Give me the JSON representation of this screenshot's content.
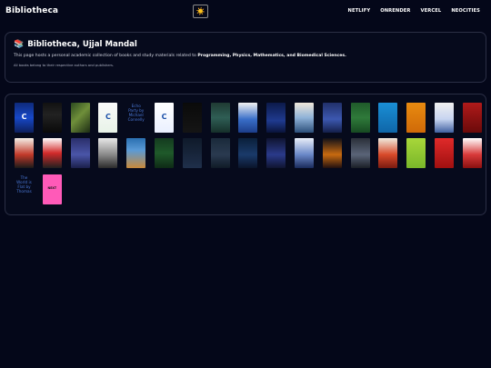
{
  "app": {
    "brand": "Bibliotheca",
    "theme_toggle_glyph": "☀️",
    "nav": [
      "NETLIFY",
      "ONRENDER",
      "VERCEL",
      "NEOCITIES"
    ]
  },
  "intro": {
    "books_icon": "📚",
    "title": "Bibliotheca, Ujjal Mandal",
    "description_start": "This page hosts a personal academic collection of books and study materials related to ",
    "description_fields": "Programming, Physics, Mathematics, and Biomedical Sciences.",
    "note": "All books belong to their respective authors and publishers."
  },
  "books": [
    {
      "kind": "cover",
      "bg": "linear-gradient(180deg,#0e2a7a 0%,#1748c8 50%,#0d1f5c 100%)",
      "title": "C"
    },
    {
      "kind": "cover",
      "bg": "linear-gradient(180deg,#111 0%,#222 40%,#0a0a0a 100%)",
      "title": ""
    },
    {
      "kind": "cover",
      "bg": "linear-gradient(135deg,#2b4a1f 0%,#6f8f3a 45%,#1c2b14 100%)",
      "title": ""
    },
    {
      "kind": "cover",
      "bg": "linear-gradient(180deg,#fafafa 0%,#e8f3e8 100%)",
      "title": "C",
      "dark": true
    },
    {
      "kind": "alt",
      "alt": "Echo Party by Michael Connelly"
    },
    {
      "kind": "cover",
      "bg": "linear-gradient(180deg,#ffffff 0%,#eaf0ff 100%)",
      "title": "C",
      "dark": true
    },
    {
      "kind": "cover",
      "bg": "linear-gradient(180deg,#0a0a0a 0%,#151515 100%)",
      "title": ""
    },
    {
      "kind": "cover",
      "bg": "linear-gradient(180deg,#1f3a33 0%,#2f5e55 50%,#16302a 100%)",
      "title": ""
    },
    {
      "kind": "cover",
      "bg": "linear-gradient(180deg,#f2f2f2 0%,#3a6fc9 55%,#1c3d8a 100%)",
      "title": ""
    },
    {
      "kind": "cover",
      "bg": "linear-gradient(180deg,#0c1a4a 0%,#1f3a8f 60%,#0a143a 100%)",
      "title": ""
    },
    {
      "kind": "cover",
      "bg": "linear-gradient(180deg,#f0e8da 0%,#8fb2d8 50%,#2c4f7a 100%)",
      "title": ""
    },
    {
      "kind": "cover",
      "bg": "linear-gradient(180deg,#21306a 0%,#3c58b0 55%,#141f4a 100%)",
      "title": ""
    },
    {
      "kind": "cover",
      "bg": "linear-gradient(180deg,#1f5a2a 0%,#2f7a3a 50%,#174a22 100%)",
      "title": ""
    },
    {
      "kind": "cover",
      "bg": "linear-gradient(180deg,#1a8fd6 0%,#0f66a8 100%)",
      "title": ""
    },
    {
      "kind": "cover",
      "bg": "linear-gradient(180deg,#e88a10 0%,#d06a08 100%)",
      "title": ""
    },
    {
      "kind": "cover",
      "bg": "linear-gradient(180deg,#f0f0f0 0%,#c7d4f0 55%,#4060a0 100%)",
      "title": ""
    },
    {
      "kind": "cover",
      "bg": "linear-gradient(180deg,#b01a1a 0%,#6a0a0a 100%)",
      "title": ""
    },
    {
      "kind": "cover",
      "bg": "linear-gradient(180deg,#1a2330 0%,#3a4a5a 50%,#0f1820 100%)",
      "title": ""
    },
    {
      "kind": "cover",
      "bg": "linear-gradient(180deg,#f5f0e8 0%,#c23a2a 55%,#1a1a1a 100%)",
      "title": ""
    },
    {
      "kind": "cover",
      "bg": "linear-gradient(180deg,#ffffff 0%,#d22a2a 50%,#202020 100%)",
      "title": ""
    },
    {
      "kind": "cover",
      "bg": "linear-gradient(180deg,#2a2f6a 0%,#4a55a8 55%,#1a1f4a 100%)",
      "title": ""
    },
    {
      "kind": "cover",
      "bg": "linear-gradient(180deg,#e8e8e8 0%,#8a8a8a 55%,#2a2a2a 100%)",
      "title": ""
    },
    {
      "kind": "cover",
      "bg": "linear-gradient(180deg,#2a6fb0 0%,#5a9ad6 40%,#c88a3a 100%)",
      "title": ""
    },
    {
      "kind": "cover",
      "bg": "linear-gradient(180deg,#143a1f 0%,#1f5a2a 50%,#0e2a16 100%)",
      "title": ""
    },
    {
      "kind": "cover",
      "bg": "linear-gradient(180deg,#0f1a2a 0%,#1f2f4a 100%)",
      "title": ""
    },
    {
      "kind": "cover",
      "bg": "linear-gradient(180deg,#1a2a3a 0%,#2a3a50 55%,#0f1a26 100%)",
      "title": ""
    },
    {
      "kind": "cover",
      "bg": "linear-gradient(180deg,#0a1f3a 0%,#1a3a6a 55%,#0a142a 100%)",
      "title": ""
    },
    {
      "kind": "cover",
      "bg": "linear-gradient(180deg,#0f1430 0%,#2a3a8a 55%,#0f1430 100%)",
      "title": ""
    },
    {
      "kind": "cover",
      "bg": "linear-gradient(180deg,#e8eef8 0%,#6a88c8 55%,#1a2a5a 100%)",
      "title": ""
    },
    {
      "kind": "cover",
      "bg": "linear-gradient(180deg,#101018 0%,#c86a10 55%,#201010 100%)",
      "title": ""
    },
    {
      "kind": "cover",
      "bg": "linear-gradient(180deg,#2a2f38 0%,#5a6478 55%,#1a1f26 100%)",
      "title": ""
    },
    {
      "kind": "cover",
      "bg": "linear-gradient(180deg,#f0ece0 0%,#d84a2a 55%,#7a1a10 100%)",
      "title": ""
    },
    {
      "kind": "cover",
      "bg": "linear-gradient(180deg,#a8d63a 0%,#7ab82a 100%)",
      "title": ""
    },
    {
      "kind": "cover",
      "bg": "linear-gradient(180deg,#e02a2a 0%,#a01010 100%)",
      "title": ""
    },
    {
      "kind": "cover",
      "bg": "linear-gradient(180deg,#ffffff 0%,#d83a3a 55%,#8a1010 100%)",
      "title": ""
    },
    {
      "kind": "cover",
      "bg": "linear-gradient(180deg,#1a1a2a 0%,#d82a2a 50%,#1a1a2a 100%)",
      "title": ""
    },
    {
      "kind": "alt",
      "alt": "The World is Flat by Thomas"
    },
    {
      "kind": "next",
      "bg": "#ff5ab8",
      "title": "NEXT"
    }
  ]
}
